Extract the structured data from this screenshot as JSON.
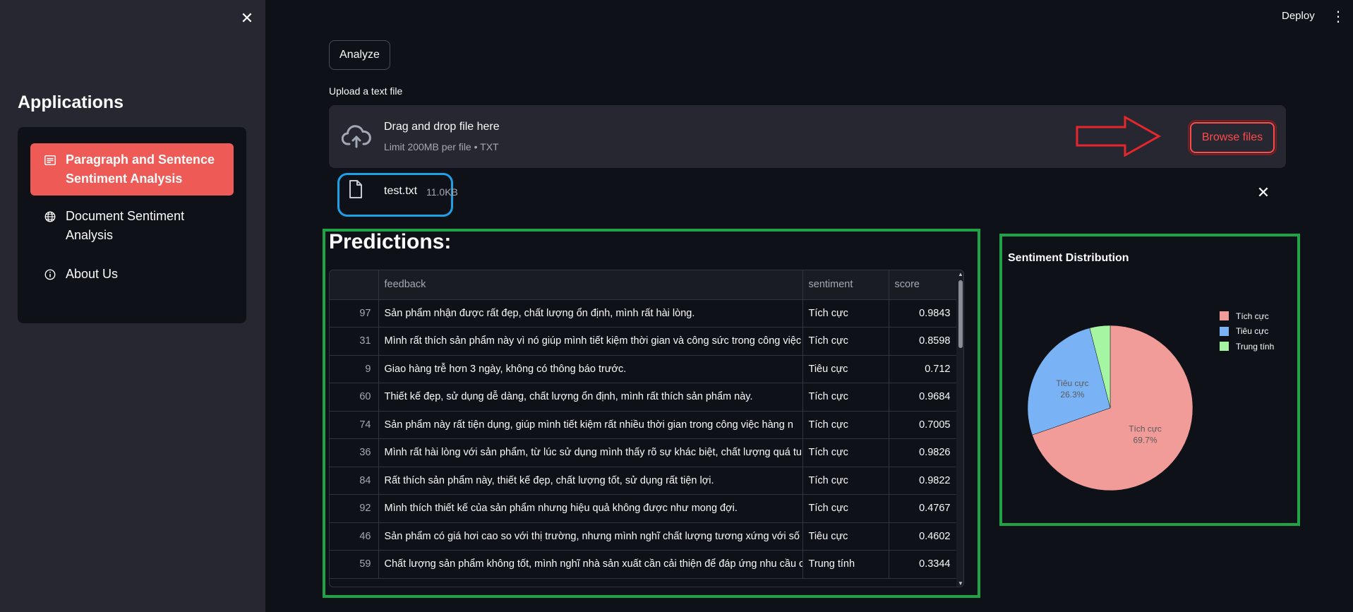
{
  "sidebar": {
    "heading": "Applications",
    "items": [
      {
        "label": "Paragraph and Sentence Sentiment Analysis",
        "icon": "article-icon",
        "active": true
      },
      {
        "label": "Document Sentiment Analysis",
        "icon": "globe-icon",
        "active": false
      },
      {
        "label": "About Us",
        "icon": "info-icon",
        "active": false
      }
    ]
  },
  "header": {
    "deploy_label": "Deploy"
  },
  "main": {
    "analyze_label": "Analyze",
    "upload_label": "Upload a text file",
    "dropzone": {
      "title": "Drag and drop file here",
      "subtitle": "Limit 200MB per file • TXT",
      "browse_label": "Browse files"
    },
    "file": {
      "name": "test.txt",
      "size": "11.0KB"
    },
    "predictions_title": "Predictions:"
  },
  "table": {
    "columns": [
      "",
      "feedback",
      "sentiment",
      "score"
    ],
    "rows": [
      {
        "idx": "97",
        "feedback": "Sản phẩm nhận được rất đẹp, chất lượng ổn định, mình rất hài lòng.",
        "sentiment": "Tích cực",
        "score": "0.9843"
      },
      {
        "idx": "31",
        "feedback": "Mình rất thích sản phẩm này vì nó giúp mình tiết kiệm thời gian và công sức trong công việc",
        "sentiment": "Tích cực",
        "score": "0.8598"
      },
      {
        "idx": "9",
        "feedback": "Giao hàng trễ hơn 3 ngày, không có thông báo trước.",
        "sentiment": "Tiêu cực",
        "score": "0.712"
      },
      {
        "idx": "60",
        "feedback": "Thiết kế đẹp, sử dụng dễ dàng, chất lượng ổn định, mình rất thích sản phẩm này.",
        "sentiment": "Tích cực",
        "score": "0.9684"
      },
      {
        "idx": "74",
        "feedback": "Sản phẩm này rất tiện dụng, giúp mình tiết kiệm rất nhiều thời gian trong công việc hàng n",
        "sentiment": "Tích cực",
        "score": "0.7005"
      },
      {
        "idx": "36",
        "feedback": "Mình rất hài lòng với sản phẩm, từ lúc sử dụng mình thấy rõ sự khác biệt, chất lượng quá tu",
        "sentiment": "Tích cực",
        "score": "0.9826"
      },
      {
        "idx": "84",
        "feedback": "Rất thích sản phẩm này, thiết kế đẹp, chất lượng tốt, sử dụng rất tiện lợi.",
        "sentiment": "Tích cực",
        "score": "0.9822"
      },
      {
        "idx": "92",
        "feedback": "Mình thích thiết kế của sản phẩm nhưng hiệu quả không được như mong đợi.",
        "sentiment": "Tích cực",
        "score": "0.4767"
      },
      {
        "idx": "46",
        "feedback": "Sản phẩm có giá hơi cao so với thị trường, nhưng mình nghĩ chất lượng tương xứng với số ti",
        "sentiment": "Tiêu cực",
        "score": "0.4602"
      },
      {
        "idx": "59",
        "feedback": "Chất lượng sản phẩm không tốt, mình nghĩ nhà sản xuất cần cải thiện để đáp ứng nhu cầu c",
        "sentiment": "Trung tính",
        "score": "0.3344"
      }
    ]
  },
  "chart_data": {
    "type": "pie",
    "title": "Sentiment Distribution",
    "slices": [
      {
        "label": "Tích cực",
        "value": 69.7,
        "color": "#f19c99",
        "text": "69.7%"
      },
      {
        "label": "Tiêu cực",
        "value": 26.3,
        "color": "#7ab3f5",
        "text": "26.3%"
      },
      {
        "label": "Trung tính",
        "value": 4.0,
        "color": "#a5f5a2",
        "text": ""
      }
    ],
    "legend": [
      "Tích cực",
      "Tiêu cực",
      "Trung tính"
    ],
    "legend_position": "right"
  },
  "colors": {
    "accent": "#ee5a55",
    "browse": "#ff4b4b",
    "annotation_green": "#1fa347",
    "annotation_blue": "#1ea0e6"
  }
}
